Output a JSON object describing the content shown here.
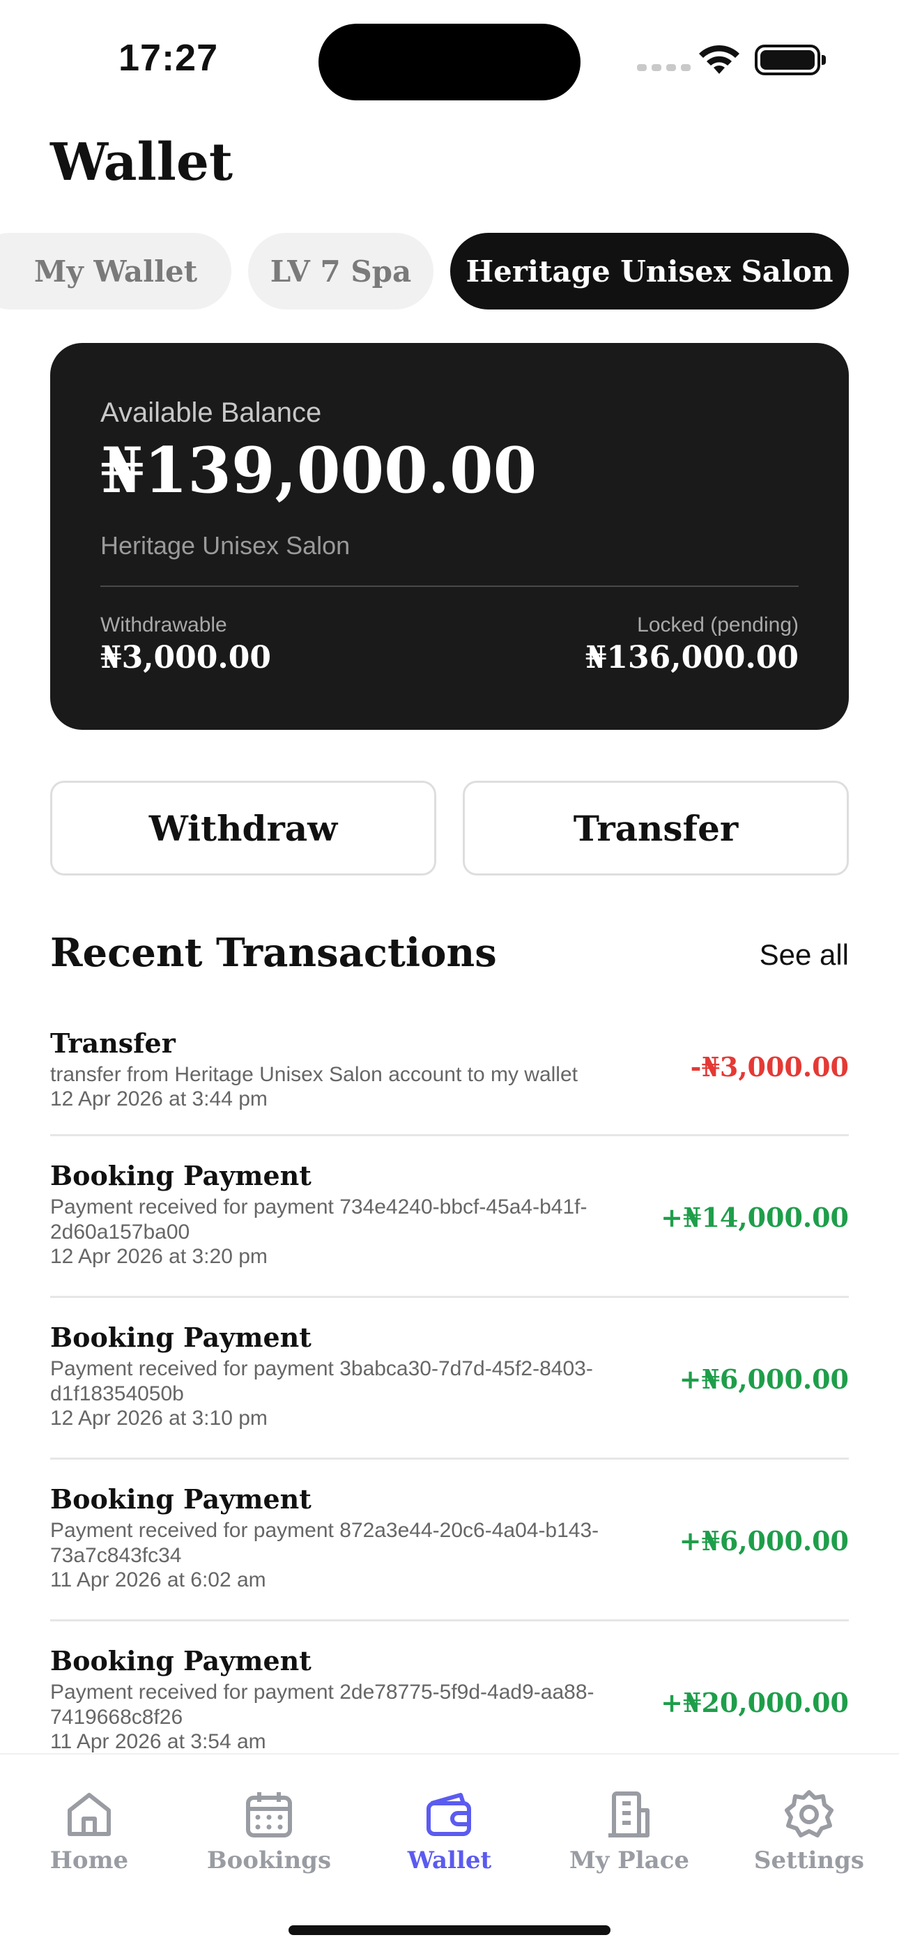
{
  "status_bar": {
    "time": "17:27"
  },
  "page": {
    "title": "Wallet"
  },
  "tabs": [
    {
      "label": "My Wallet",
      "active": false
    },
    {
      "label": "LV 7 Spa",
      "active": false
    },
    {
      "label": "Heritage Unisex Salon",
      "active": true
    }
  ],
  "balance_card": {
    "label": "Available Balance",
    "amount": "₦139,000.00",
    "owner": "Heritage Unisex Salon",
    "withdrawable_label": "Withdrawable",
    "withdrawable_value": "₦3,000.00",
    "locked_label": "Locked (pending)",
    "locked_value": "₦136,000.00"
  },
  "actions": {
    "withdraw_label": "Withdraw",
    "transfer_label": "Transfer"
  },
  "recent": {
    "title": "Recent Transactions",
    "see_all": "See all",
    "transactions": [
      {
        "title": "Transfer",
        "description": "transfer from Heritage Unisex Salon account to my wallet",
        "date": "12 Apr 2026 at 3:44 pm",
        "amount": "-₦3,000.00"
      },
      {
        "title": "Booking Payment",
        "description": "Payment received for payment 734e4240-bbcf-45a4-b41f-2d60a157ba00",
        "date": "12 Apr 2026 at 3:20 pm",
        "amount": "+₦14,000.00"
      },
      {
        "title": "Booking Payment",
        "description": "Payment received for payment 3babca30-7d7d-45f2-8403-d1f18354050b",
        "date": "12 Apr 2026 at 3:10 pm",
        "amount": "+₦6,000.00"
      },
      {
        "title": "Booking Payment",
        "description": "Payment received for payment 872a3e44-20c6-4a04-b143-73a7c843fc34",
        "date": "11 Apr 2026 at 6:02 am",
        "amount": "+₦6,000.00"
      },
      {
        "title": "Booking Payment",
        "description": "Payment received for payment 2de78775-5f9d-4ad9-aa88-7419668c8f26",
        "date": "11 Apr 2026 at 3:54 am",
        "amount": "+₦20,000.00"
      }
    ]
  },
  "nav": {
    "items": [
      {
        "label": "Home",
        "icon": "home-icon",
        "active": false
      },
      {
        "label": "Bookings",
        "icon": "calendar-icon",
        "active": false
      },
      {
        "label": "Wallet",
        "icon": "wallet-icon",
        "active": true
      },
      {
        "label": "My Place",
        "icon": "building-icon",
        "active": false
      },
      {
        "label": "Settings",
        "icon": "gear-icon",
        "active": false
      }
    ],
    "active_color": "#5b5bf0",
    "inactive_color": "#9a9ca3"
  },
  "colors": {
    "negative": "#e53935",
    "positive": "#1e9e4a",
    "card": "#1a1a1a"
  }
}
